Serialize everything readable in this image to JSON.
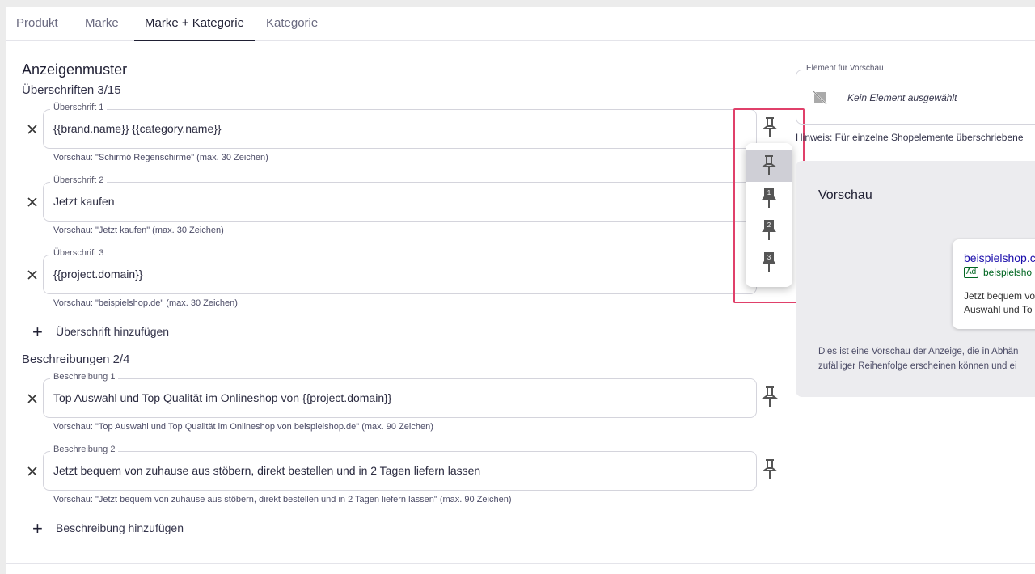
{
  "tabs": [
    "Produkt",
    "Marke",
    "Marke + Kategorie",
    "Kategorie"
  ],
  "section_title": "Anzeigenmuster",
  "headlines": {
    "heading": "Überschriften 3/15",
    "items": [
      {
        "label": "Überschrift 1",
        "value": "{{brand.name}} {{category.name}}",
        "hint": "Vorschau: \"Schirmó Regenschirme\" (max. 30 Zeichen)"
      },
      {
        "label": "Überschrift 2",
        "value": "Jetzt kaufen",
        "hint": "Vorschau: \"Jetzt kaufen\" (max. 30 Zeichen)"
      },
      {
        "label": "Überschrift 3",
        "value": "{{project.domain}}",
        "hint": "Vorschau: \"beispielshop.de\" (max. 30 Zeichen)"
      }
    ],
    "add_label": "Überschrift hinzufügen"
  },
  "descriptions": {
    "heading": "Beschreibungen 2/4",
    "items": [
      {
        "label": "Beschreibung 1",
        "value": "Top Auswahl und Top Qualität im Onlineshop von {{project.domain}}",
        "hint": "Vorschau: \"Top Auswahl und Top Qualität im Onlineshop von beispielshop.de\" (max. 90 Zeichen)"
      },
      {
        "label": "Beschreibung 2",
        "value": "Jetzt bequem von zuhause aus stöbern, direkt bestellen und in 2 Tagen liefern lassen",
        "hint": "Vorschau: \"Jetzt bequem von zuhause aus stöbern, direkt bestellen und in 2 Tagen liefern lassen\" (max. 90 Zeichen)"
      }
    ],
    "add_label": "Beschreibung hinzufügen"
  },
  "pin_menu": {
    "options": [
      "",
      "1",
      "2",
      "3"
    ],
    "selected_index": 0
  },
  "preview_element": {
    "label": "Element für Vorschau",
    "empty_text": "Kein Element ausgewählt"
  },
  "notice": "Hinweis: Für einzelne Shopelemente überschriebene",
  "preview": {
    "title": "Vorschau",
    "ad": {
      "headline": "beispielshop.c",
      "badge": "Ad",
      "url": "beispielsho",
      "desc_line1": "Jetzt bequem vo",
      "desc_line2": "Auswahl und To"
    },
    "note_line1": "Dies ist eine Vorschau der Anzeige, die in Abhän",
    "note_line2": "zufälliger Reihenfolge erscheinen können und ei"
  },
  "colors": {
    "highlight": "#e0406a",
    "ad_link": "#1a0dab",
    "ad_url": "#006621"
  },
  "icons": [
    "close-icon",
    "pin-icon",
    "plus-icon",
    "no-image-icon"
  ]
}
